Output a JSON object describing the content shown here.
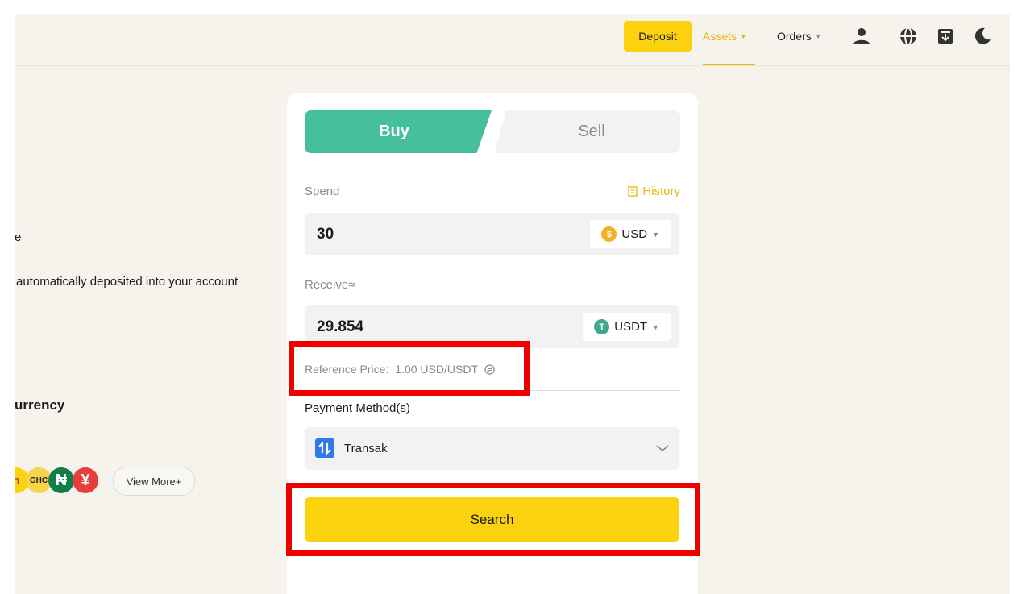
{
  "header": {
    "deposit_label": "Deposit",
    "assets_label": "Assets",
    "orders_label": "Orders",
    "icons": [
      "user-icon",
      "globe-icon",
      "download-icon",
      "moon-icon"
    ],
    "accent_color": "#e9b50c",
    "deposit_color": "#fcd20f"
  },
  "left_panel": {
    "line_fragment": "e",
    "deposit_note": "automatically deposited into your account",
    "section_heading": "urrency",
    "coins": [
      {
        "symbol": "h",
        "color": "#fcd20f"
      },
      {
        "symbol": "GHC",
        "color": "#f7d44a"
      },
      {
        "symbol": "₦",
        "color": "#127c4b"
      },
      {
        "symbol": "¥",
        "color": "#e83d3d"
      }
    ],
    "view_more_label": "View More+"
  },
  "trade_card": {
    "tabs": [
      {
        "label": "Buy",
        "active": true
      },
      {
        "label": "Sell",
        "active": false
      }
    ],
    "buy_color": "#45bf9c",
    "spend_label": "Spend",
    "history_label": "History",
    "spend_value": "30",
    "spend_currency": "USD",
    "receive_label": "Receive≈",
    "receive_value": "29.854",
    "receive_currency": "USDT",
    "reference_price_label": "Reference Price:",
    "reference_price_value": "1.00 USD/USDT",
    "payment_method_label": "Payment Method(s)",
    "payment_method_value": "Transak",
    "search_label": "Search",
    "search_color": "#fcd20f"
  },
  "annotations": {
    "highlight_color": "#ee0000",
    "highlighted": [
      "reference-price-row",
      "search-button"
    ]
  }
}
